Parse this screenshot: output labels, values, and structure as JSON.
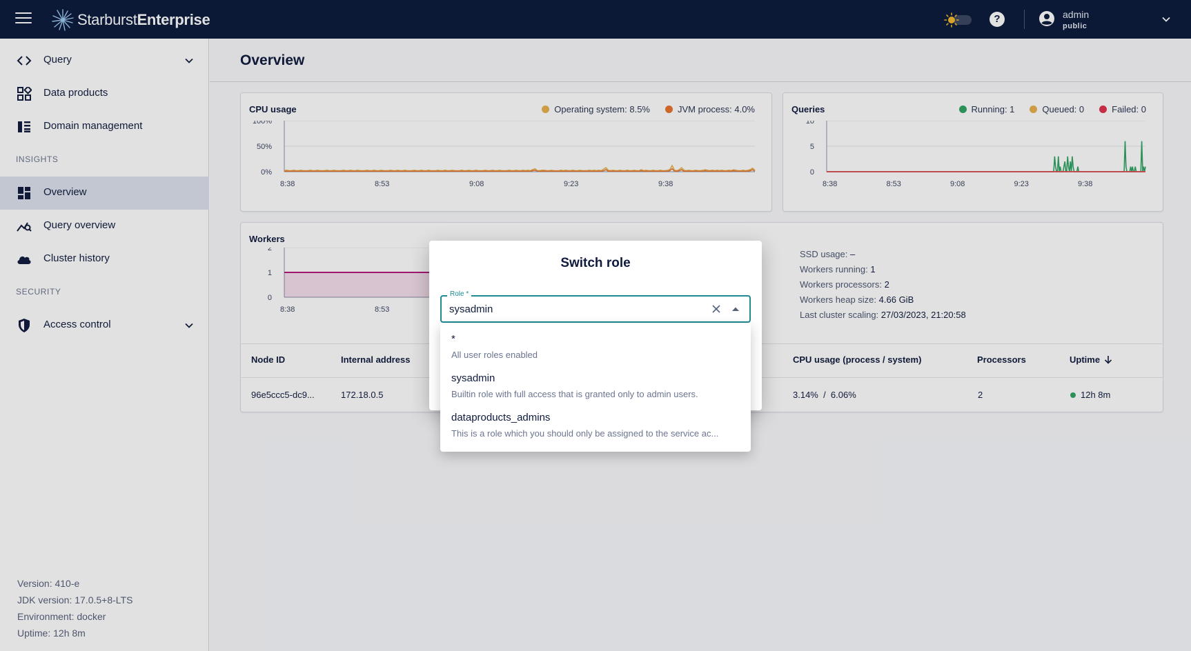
{
  "app": {
    "brand_light": "Starburst",
    "brand_bold": "Enterprise"
  },
  "topbar": {
    "user_name": "admin",
    "user_role": "public"
  },
  "sidebar": {
    "items": [
      {
        "label": "Query"
      },
      {
        "label": "Data products"
      },
      {
        "label": "Domain management"
      },
      {
        "label": "Overview"
      },
      {
        "label": "Query overview"
      },
      {
        "label": "Cluster history"
      },
      {
        "label": "Access control"
      }
    ],
    "sections": {
      "insights": "INSIGHTS",
      "security": "SECURITY"
    },
    "footer": {
      "version": "Version: 410-e",
      "jdk": "JDK version: 17.0.5+8-LTS",
      "environment": "Environment: docker",
      "uptime": "Uptime: 12h 8m"
    }
  },
  "page": {
    "title": "Overview"
  },
  "cards": {
    "cpu": {
      "title": "CPU usage",
      "legend_os": "Operating system: 8.5%",
      "legend_jvm": "JVM process: 4.0%"
    },
    "queries": {
      "title": "Queries",
      "legend_running": "Running: 1",
      "legend_queued": "Queued: 0",
      "legend_failed": "Failed: 0"
    },
    "workers": {
      "title": "Workers"
    }
  },
  "stats": {
    "ssd_label": "SSD usage:",
    "ssd_value": "–",
    "running_label": "Workers running:",
    "running_value": "1",
    "processors_label": "Workers processors:",
    "processors_value": "2",
    "heap_label": "Workers heap size:",
    "heap_value": "4.66 GiB",
    "scaling_label": "Last cluster scaling:",
    "scaling_value": "27/03/2023, 21:20:58"
  },
  "table": {
    "headers": {
      "node_id": "Node ID",
      "internal_address": "Internal address",
      "cpu_usage": "CPU usage (process / system)",
      "processors": "Processors",
      "uptime": "Uptime"
    },
    "row": {
      "node_id": "96e5ccc5-dc9...",
      "internal_address": "172.18.0.5",
      "cpu_usage": "3.14%  /  6.06%",
      "processors": "2",
      "uptime": "12h 8m"
    }
  },
  "dialog": {
    "title": "Switch role",
    "field_label": "Role *",
    "field_value": "sysadmin",
    "options": [
      {
        "name": "*",
        "description": "All user roles enabled"
      },
      {
        "name": "sysadmin",
        "description": "Builtin role with full access that is granted only to admin users."
      },
      {
        "name": "dataproducts_admins",
        "description": "This is a role which you should only be assigned to the service ac..."
      }
    ]
  },
  "colors": {
    "topbar": "#0a1a3c",
    "os": "#e8b04b",
    "jvm": "#e8722c",
    "running": "#2fa463",
    "queued": "#e8b04b",
    "failed": "#e0314b",
    "workers": "#b3187a",
    "focus": "#1d8a91"
  },
  "chart_data": [
    {
      "type": "line",
      "title": "CPU usage",
      "x_ticks": [
        "8:38",
        "8:53",
        "9:08",
        "9:23",
        "9:38"
      ],
      "y_ticks": [
        "100%",
        "50%",
        "0%"
      ],
      "ylim": [
        0,
        100
      ],
      "series": [
        {
          "name": "Operating system: 8.5%",
          "color": "#e8b04b",
          "values": [
            2,
            3,
            2,
            2,
            3,
            2,
            2,
            3,
            2,
            2,
            2,
            3,
            2,
            2,
            3,
            2,
            2,
            2,
            3,
            2,
            2,
            3,
            2,
            2,
            2,
            3,
            2,
            2,
            3,
            2,
            2,
            3,
            2,
            2,
            2,
            3,
            2,
            2,
            3,
            2,
            2,
            3,
            2,
            2,
            2,
            3,
            2,
            2,
            3,
            2,
            2,
            3,
            2,
            2,
            2,
            3,
            2,
            2,
            3,
            2,
            2,
            3,
            2,
            2,
            2,
            3,
            2,
            2,
            3,
            2,
            2,
            3,
            2,
            2,
            2,
            3,
            2,
            2,
            3,
            2,
            2,
            3,
            2,
            2,
            2,
            3,
            2,
            2,
            3,
            2,
            2,
            3,
            2,
            2,
            2,
            3,
            2,
            2,
            3,
            2,
            2,
            3,
            2,
            3,
            2,
            4,
            6,
            2,
            2,
            3,
            3,
            2,
            2,
            3,
            2,
            2,
            2,
            3,
            2,
            3,
            2,
            2,
            3,
            2,
            2,
            3,
            2,
            2,
            2,
            3,
            2,
            3,
            2,
            3,
            2,
            5,
            8,
            3,
            2,
            3,
            2,
            2,
            3,
            2,
            2,
            3,
            2,
            2,
            3,
            2,
            2,
            4,
            2,
            3,
            2,
            2,
            3,
            2,
            2,
            3,
            2,
            2,
            3,
            4,
            12,
            3,
            2,
            4,
            8,
            3,
            2,
            3,
            2,
            2,
            3,
            2,
            2,
            3,
            4,
            3,
            2,
            3,
            2,
            3,
            2,
            3,
            2,
            2,
            3,
            2,
            4,
            3,
            2,
            2,
            3,
            2,
            3,
            4,
            7,
            3
          ]
        },
        {
          "name": "JVM process: 4.0%",
          "color": "#e8722c",
          "values": [
            1,
            1,
            1,
            1,
            1,
            1,
            1,
            1,
            1,
            1,
            1,
            1,
            1,
            1,
            1,
            1,
            1,
            1,
            1,
            1,
            1,
            1,
            1,
            1,
            1,
            1,
            1,
            1,
            1,
            1,
            1,
            1,
            1,
            1,
            1,
            1,
            1,
            1,
            1,
            1,
            1,
            1,
            1,
            1,
            1,
            1,
            1,
            1,
            1,
            1,
            1,
            1,
            1,
            1,
            1,
            1,
            1,
            1,
            1,
            1,
            1,
            1,
            1,
            1,
            1,
            1,
            1,
            1,
            1,
            1,
            1,
            1,
            1,
            1,
            1,
            1,
            1,
            1,
            1,
            1,
            1,
            1,
            1,
            1,
            1,
            1,
            1,
            1,
            1,
            1,
            1,
            1,
            1,
            1,
            1,
            1,
            1,
            1,
            1,
            1,
            1,
            1,
            1,
            1,
            1,
            2,
            3,
            1,
            1,
            1,
            1,
            1,
            1,
            1,
            1,
            1,
            1,
            1,
            1,
            1,
            1,
            1,
            1,
            1,
            1,
            1,
            1,
            1,
            1,
            1,
            1,
            1,
            1,
            1,
            1,
            2,
            4,
            1,
            1,
            1,
            1,
            1,
            1,
            1,
            1,
            1,
            1,
            1,
            1,
            1,
            1,
            2,
            1,
            1,
            1,
            1,
            1,
            1,
            1,
            1,
            1,
            1,
            1,
            2,
            6,
            1,
            1,
            2,
            4,
            1,
            1,
            1,
            1,
            1,
            1,
            1,
            1,
            1,
            2,
            1,
            1,
            1,
            1,
            1,
            1,
            1,
            1,
            1,
            1,
            1,
            2,
            1,
            1,
            1,
            1,
            1,
            1,
            2,
            4,
            1
          ]
        }
      ]
    },
    {
      "type": "line",
      "title": "Queries",
      "x_ticks": [
        "8:38",
        "8:53",
        "9:08",
        "9:23",
        "9:38"
      ],
      "y_ticks": [
        "10",
        "5",
        "0"
      ],
      "ylim": [
        0,
        10
      ],
      "series": [
        {
          "name": "Running: 1",
          "color": "#2fa463",
          "values": [
            0,
            0,
            0,
            0,
            0,
            0,
            0,
            0,
            0,
            0,
            0,
            0,
            0,
            0,
            0,
            0,
            0,
            0,
            0,
            0,
            0,
            0,
            0,
            0,
            0,
            0,
            0,
            0,
            0,
            0,
            0,
            0,
            0,
            0,
            0,
            0,
            0,
            0,
            0,
            0,
            0,
            0,
            0,
            0,
            0,
            0,
            0,
            0,
            0,
            0,
            0,
            0,
            0,
            0,
            0,
            0,
            0,
            0,
            0,
            0,
            0,
            0,
            0,
            0,
            0,
            0,
            0,
            0,
            0,
            0,
            0,
            0,
            0,
            0,
            0,
            0,
            0,
            0,
            0,
            0,
            0,
            0,
            0,
            0,
            0,
            0,
            0,
            0,
            0,
            0,
            0,
            0,
            0,
            0,
            0,
            0,
            0,
            0,
            0,
            0,
            0,
            0,
            0,
            0,
            0,
            0,
            0,
            0,
            0,
            0,
            0,
            0,
            0,
            0,
            0,
            0,
            0,
            0,
            0,
            0,
            0,
            0,
            0,
            0,
            0,
            0,
            0,
            0,
            0,
            0,
            0,
            0,
            0,
            0,
            0,
            0,
            0,
            0,
            0,
            0,
            0,
            0,
            0,
            0,
            0,
            0,
            0,
            0,
            0,
            0,
            0,
            0,
            0,
            0,
            0,
            0,
            0,
            0,
            0,
            0,
            0,
            0,
            0,
            0,
            0,
            0,
            0,
            0,
            0,
            0,
            0,
            0,
            0,
            0,
            0,
            0,
            0,
            0,
            0,
            0,
            0,
            0,
            0,
            0,
            0,
            0,
            0,
            0,
            0,
            0,
            0,
            0,
            0,
            0,
            0,
            0,
            0,
            0,
            0,
            0,
            0,
            0,
            0,
            0,
            0,
            0,
            0,
            0,
            0,
            0,
            0,
            0,
            0,
            0,
            0,
            0,
            0,
            0,
            0,
            0,
            0,
            0,
            0,
            0,
            0,
            0,
            0,
            0,
            0,
            0,
            0,
            0,
            0,
            0,
            0,
            0,
            0,
            0,
            0,
            0,
            0,
            0,
            0,
            0,
            0,
            0,
            3,
            1,
            0,
            0,
            3,
            0,
            1,
            0,
            0,
            0,
            1,
            2,
            0,
            0,
            3,
            1,
            0,
            2,
            0,
            3,
            1,
            0,
            0,
            0,
            0,
            1,
            0,
            0,
            0,
            0,
            0,
            0,
            0,
            0,
            0,
            0,
            0,
            0,
            0,
            0,
            0,
            0,
            0,
            0,
            0,
            0,
            0,
            0,
            0,
            0,
            0,
            0,
            0,
            0,
            0,
            0,
            0,
            0,
            0,
            0,
            0,
            0,
            0,
            0,
            0,
            0,
            0,
            0,
            0,
            0,
            0,
            0,
            0,
            0,
            0,
            0,
            6,
            1,
            0,
            0,
            0,
            0,
            1,
            0,
            1,
            0,
            0,
            1,
            0,
            0,
            0,
            0,
            0,
            0,
            6,
            0,
            1,
            0,
            1
          ]
        },
        {
          "name": "Queued: 0",
          "color": "#e8b04b",
          "values": [
            0,
            0,
            0,
            0,
            0
          ]
        },
        {
          "name": "Failed: 0",
          "color": "#e0314b",
          "values": [
            0,
            0,
            0,
            0,
            0
          ]
        }
      ]
    },
    {
      "type": "area",
      "title": "Workers",
      "x_ticks": [
        "8:38",
        "8:53"
      ],
      "y_ticks": [
        "2",
        "1",
        "0"
      ],
      "ylim": [
        0,
        2
      ],
      "series": [
        {
          "name": "Workers running",
          "color": "#b3187a",
          "values": [
            1,
            1,
            1,
            1,
            1,
            1,
            1,
            1,
            1,
            1
          ]
        }
      ]
    }
  ]
}
